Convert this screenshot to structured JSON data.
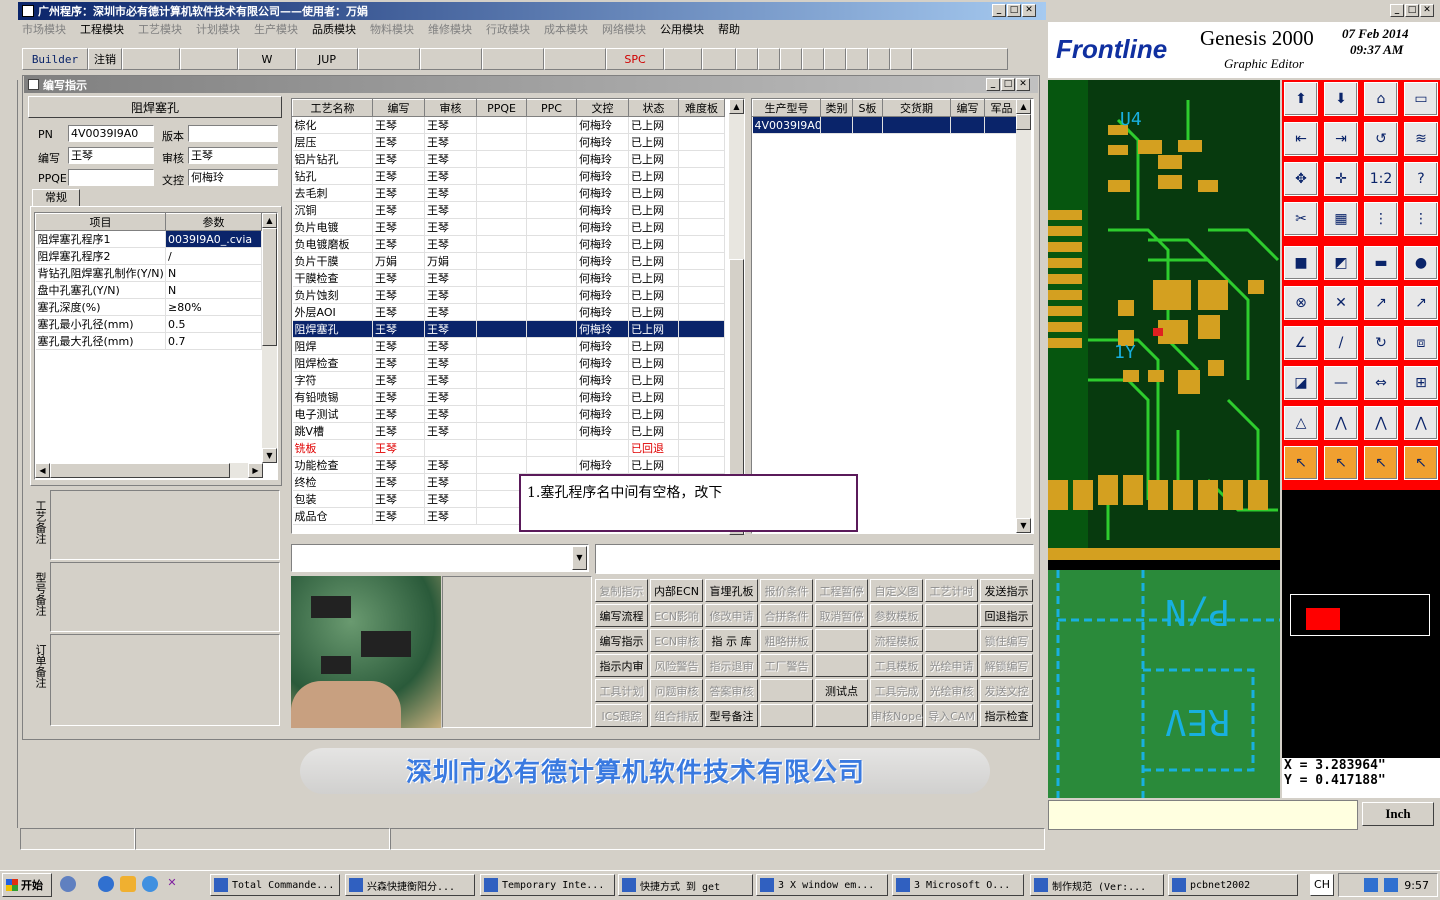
{
  "app": {
    "title": "广州程序：深圳市必有德计算机软件技术有限公司——使用者：万娟",
    "menu": [
      "市场模块",
      "工程模块",
      "工艺模块",
      "计划模块",
      "生产模块",
      "品质模块",
      "物料模块",
      "维修模块",
      "行政模块",
      "成本模块",
      "网络模块",
      "公用模块",
      "帮助"
    ],
    "toolbar": [
      "Builder",
      "注销",
      "",
      "",
      "W",
      "JUP",
      "",
      "",
      "",
      "",
      "SPC",
      "",
      "",
      "",
      "",
      "",
      "",
      "",
      "",
      "",
      "",
      ""
    ]
  },
  "child": {
    "title": "编写指示",
    "section_title": "阻焊塞孔",
    "labels": {
      "pn": "PN",
      "version": "版本",
      "writer": "编写",
      "reviewer": "审核",
      "ppqe": "PPQE",
      "doc_ctrl": "文控",
      "tab": "常规"
    },
    "values": {
      "pn": "4V0039I9A0",
      "version": "",
      "writer": "王琴",
      "reviewer": "王琴",
      "ppqe": "",
      "doc_ctrl": "何梅玲"
    },
    "params_headers": [
      "项目",
      "参数"
    ],
    "params": [
      [
        "阻焊塞孔程序1",
        "0039I9A0_.cvia"
      ],
      [
        "阻焊塞孔程序2",
        "/"
      ],
      [
        "背钻孔阻焊塞孔制作(Y/N)",
        "N"
      ],
      [
        "盘中孔塞孔(Y/N)",
        "N"
      ],
      [
        "塞孔深度(%)",
        "≥80%"
      ],
      [
        "塞孔最小孔径(mm)",
        "0.5"
      ],
      [
        "塞孔最大孔径(mm)",
        "0.7"
      ]
    ],
    "side_notes": [
      "工艺备注",
      "型号备注",
      "订单备注"
    ],
    "process_headers": [
      "工艺名称",
      "编写",
      "审核",
      "PPQE",
      "PPC",
      "文控",
      "状态",
      "难度板"
    ],
    "processes": [
      [
        "棕化",
        "王琴",
        "王琴",
        "",
        "",
        "何梅玲",
        "已上网"
      ],
      [
        "层压",
        "王琴",
        "王琴",
        "",
        "",
        "何梅玲",
        "已上网"
      ],
      [
        "铝片钻孔",
        "王琴",
        "王琴",
        "",
        "",
        "何梅玲",
        "已上网"
      ],
      [
        "钻孔",
        "王琴",
        "王琴",
        "",
        "",
        "何梅玲",
        "已上网"
      ],
      [
        "去毛刺",
        "王琴",
        "王琴",
        "",
        "",
        "何梅玲",
        "已上网"
      ],
      [
        "沉铜",
        "王琴",
        "王琴",
        "",
        "",
        "何梅玲",
        "已上网"
      ],
      [
        "负片电镀",
        "王琴",
        "王琴",
        "",
        "",
        "何梅玲",
        "已上网"
      ],
      [
        "负电镀磨板",
        "王琴",
        "王琴",
        "",
        "",
        "何梅玲",
        "已上网"
      ],
      [
        "负片干膜",
        "万娟",
        "万娟",
        "",
        "",
        "何梅玲",
        "已上网"
      ],
      [
        "干膜检查",
        "王琴",
        "王琴",
        "",
        "",
        "何梅玲",
        "已上网"
      ],
      [
        "负片蚀刻",
        "王琴",
        "王琴",
        "",
        "",
        "何梅玲",
        "已上网"
      ],
      [
        "外层AOI",
        "王琴",
        "王琴",
        "",
        "",
        "何梅玲",
        "已上网"
      ],
      [
        "阻焊塞孔",
        "王琴",
        "王琴",
        "",
        "",
        "何梅玲",
        "已上网"
      ],
      [
        "阻焊",
        "王琴",
        "王琴",
        "",
        "",
        "何梅玲",
        "已上网"
      ],
      [
        "阻焊检查",
        "王琴",
        "王琴",
        "",
        "",
        "何梅玲",
        "已上网"
      ],
      [
        "字符",
        "王琴",
        "王琴",
        "",
        "",
        "何梅玲",
        "已上网"
      ],
      [
        "有铅喷锡",
        "王琴",
        "王琴",
        "",
        "",
        "何梅玲",
        "已上网"
      ],
      [
        "电子测试",
        "王琴",
        "王琴",
        "",
        "",
        "何梅玲",
        "已上网"
      ],
      [
        "跳V槽",
        "王琴",
        "王琴",
        "",
        "",
        "何梅玲",
        "已上网"
      ],
      [
        "铣板",
        "王琴",
        "",
        "",
        "",
        "",
        "已回退"
      ],
      [
        "功能检查",
        "王琴",
        "王琴",
        "",
        "",
        "何梅玲",
        "已上网"
      ],
      [
        "终检",
        "王琴",
        "王琴",
        "",
        "",
        "",
        ""
      ],
      [
        "包装",
        "王琴",
        "王琴",
        "",
        "",
        "",
        ""
      ],
      [
        "成品仓",
        "王琴",
        "王琴",
        "",
        "",
        "",
        ""
      ]
    ],
    "order_headers": [
      "生产型号",
      "类别",
      "S板",
      "交货期",
      "编写",
      "军品"
    ],
    "orders": [
      [
        "4V0039I9A0",
        "",
        "",
        "",
        "",
        ""
      ]
    ],
    "note": "1.塞孔程序名中间有空格，改下",
    "buttons": [
      [
        "复制指示",
        "内部ECN",
        "盲埋孔板",
        "报价条件",
        "工程暂停",
        "自定义图",
        "工艺计时",
        "发送指示"
      ],
      [
        "编写流程",
        "ECN影响",
        "修改申请",
        "合拼条件",
        "取消暂停",
        "参数模板",
        "",
        "回退指示"
      ],
      [
        "编写指示",
        "ECN审核",
        "指 示 库",
        "粗略拼板",
        "",
        "流程模板",
        "",
        "锁住编写"
      ],
      [
        "指示内审",
        "风险警告",
        "指示退审",
        "工厂警告",
        "",
        "工具模板",
        "光绘申请",
        "解锁编写"
      ],
      [
        "工具计划",
        "问题审核",
        "答案审核",
        "",
        "测试点",
        "工具完成",
        "光绘审核",
        "发送文控"
      ],
      [
        "ICS跟踪",
        "组合排版",
        "型号备注",
        "",
        "",
        "审核Nope",
        "导入CAM",
        "指示检查"
      ]
    ],
    "buttons_enabled": [
      "内部ECN",
      "盲埋孔板",
      "发送指示",
      "编写流程",
      "回退指示",
      "编写指示",
      "指 示 库",
      "指示内审",
      "测试点",
      "型号备注",
      "指示检查"
    ]
  },
  "footer_company": "深圳市必有德计算机软件技术有限公司",
  "genesis": {
    "brand": "Frontline",
    "product": "Genesis 2000",
    "subtitle": "Graphic Editor",
    "date": "07 Feb 2014",
    "time": "09:37 AM",
    "coord_x": "X = 3.283964\"",
    "coord_y": "Y = 0.417188\"",
    "units": "Inch",
    "silk_u4": "U4",
    "silk_1y": "1Y",
    "silk_pn": "P/N",
    "silk_rev": "REV"
  },
  "taskbar": {
    "start": "开始",
    "items": [
      "Total Commande...",
      "兴森快捷衡阳分...",
      "Temporary Inte...",
      "快捷方式 到 get",
      "3 X window em...",
      "3 Microsoft O...",
      "制作规范 (Ver:...",
      "pcbnet2002"
    ],
    "lang": "CH",
    "clock": "9:57"
  }
}
